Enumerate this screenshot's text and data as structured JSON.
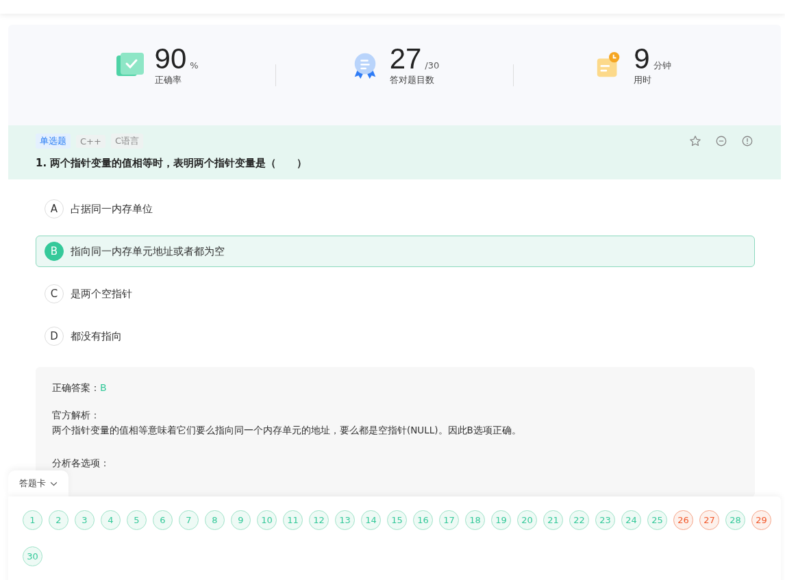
{
  "stats": [
    {
      "kind": "accuracy",
      "value": "90",
      "unit": "%",
      "label": "正确率"
    },
    {
      "kind": "correct",
      "value": "27",
      "unit": "/30",
      "label": "答对题目数"
    },
    {
      "kind": "time",
      "value": "9",
      "unit": "分钟",
      "label": "用时"
    }
  ],
  "question": {
    "tags": [
      {
        "text": "单选题",
        "kind": "type"
      },
      {
        "text": "C++",
        "kind": "topic"
      },
      {
        "text": "C语言",
        "kind": "topic"
      }
    ],
    "title": "1. 两个指针变量的值相等时，表明两个指针变量是（　　）",
    "options": [
      {
        "letter": "A",
        "text": "占据同一内存单位",
        "selected": false
      },
      {
        "letter": "B",
        "text": "指向同一内存单元地址或者都为空",
        "selected": true
      },
      {
        "letter": "C",
        "text": "是两个空指针",
        "selected": false
      },
      {
        "letter": "D",
        "text": "都没有指向",
        "selected": false
      }
    ]
  },
  "analysis": {
    "answer_label": "正确答案：",
    "answer": "B",
    "heading": "官方解析：",
    "body": "两个指针变量的值相等意味着它们要么指向同一个内存单元的地址，要么都是空指针(NULL)。因此B选项正确。",
    "sub_heading": "分析各选项："
  },
  "answer_card": {
    "title": "答题卡",
    "items": [
      {
        "n": "1",
        "correct": true
      },
      {
        "n": "2",
        "correct": true
      },
      {
        "n": "3",
        "correct": true
      },
      {
        "n": "4",
        "correct": true
      },
      {
        "n": "5",
        "correct": true
      },
      {
        "n": "6",
        "correct": true
      },
      {
        "n": "7",
        "correct": true
      },
      {
        "n": "8",
        "correct": true
      },
      {
        "n": "9",
        "correct": true
      },
      {
        "n": "10",
        "correct": true
      },
      {
        "n": "11",
        "correct": true
      },
      {
        "n": "12",
        "correct": true
      },
      {
        "n": "13",
        "correct": true
      },
      {
        "n": "14",
        "correct": true
      },
      {
        "n": "15",
        "correct": true
      },
      {
        "n": "16",
        "correct": true
      },
      {
        "n": "17",
        "correct": true
      },
      {
        "n": "18",
        "correct": true
      },
      {
        "n": "19",
        "correct": true
      },
      {
        "n": "20",
        "correct": true
      },
      {
        "n": "21",
        "correct": true
      },
      {
        "n": "22",
        "correct": true
      },
      {
        "n": "23",
        "correct": true
      },
      {
        "n": "24",
        "correct": true
      },
      {
        "n": "25",
        "correct": true
      },
      {
        "n": "26",
        "correct": false
      },
      {
        "n": "27",
        "correct": false
      },
      {
        "n": "28",
        "correct": true
      },
      {
        "n": "29",
        "correct": false
      },
      {
        "n": "30",
        "correct": true
      }
    ]
  }
}
